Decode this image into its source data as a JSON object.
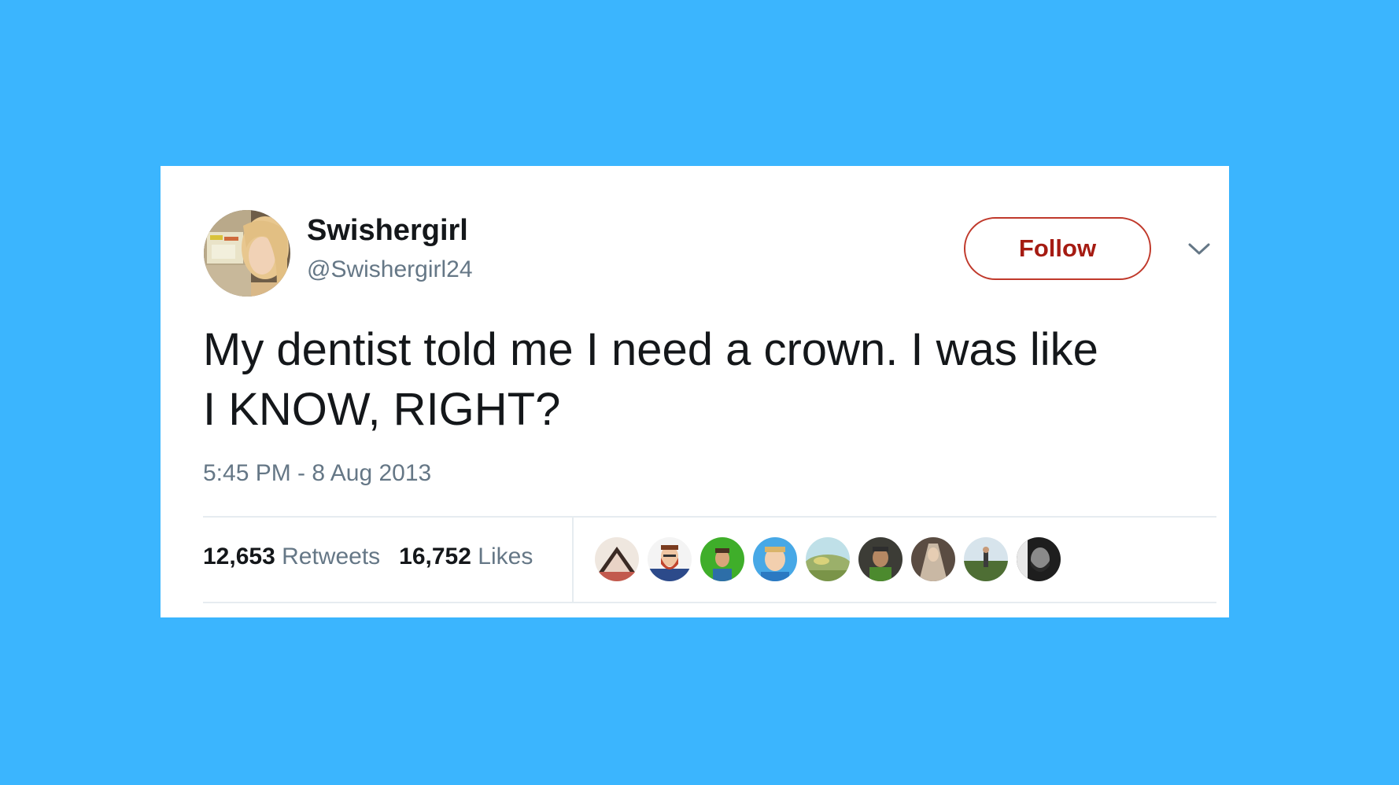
{
  "tweet": {
    "display_name": "Swishergirl",
    "handle": "@Swishergirl24",
    "follow_label": "Follow",
    "text_line1": "My dentist told me I need a crown. I was like",
    "text_line2": "I KNOW, RIGHT?",
    "timestamp": "5:45 PM - 8 Aug 2013",
    "retweets_count": "12,653",
    "retweets_label": "Retweets",
    "likes_count": "16,752",
    "likes_label": "Likes"
  },
  "icons": {
    "caret": "chevron-down-icon",
    "avatar": "profile-avatar"
  },
  "colors": {
    "background": "#3bb5fe",
    "card": "#ffffff",
    "follow_border": "#c0392b",
    "follow_text": "#a51b12",
    "muted_text": "#657786",
    "primary_text": "#14171a"
  }
}
